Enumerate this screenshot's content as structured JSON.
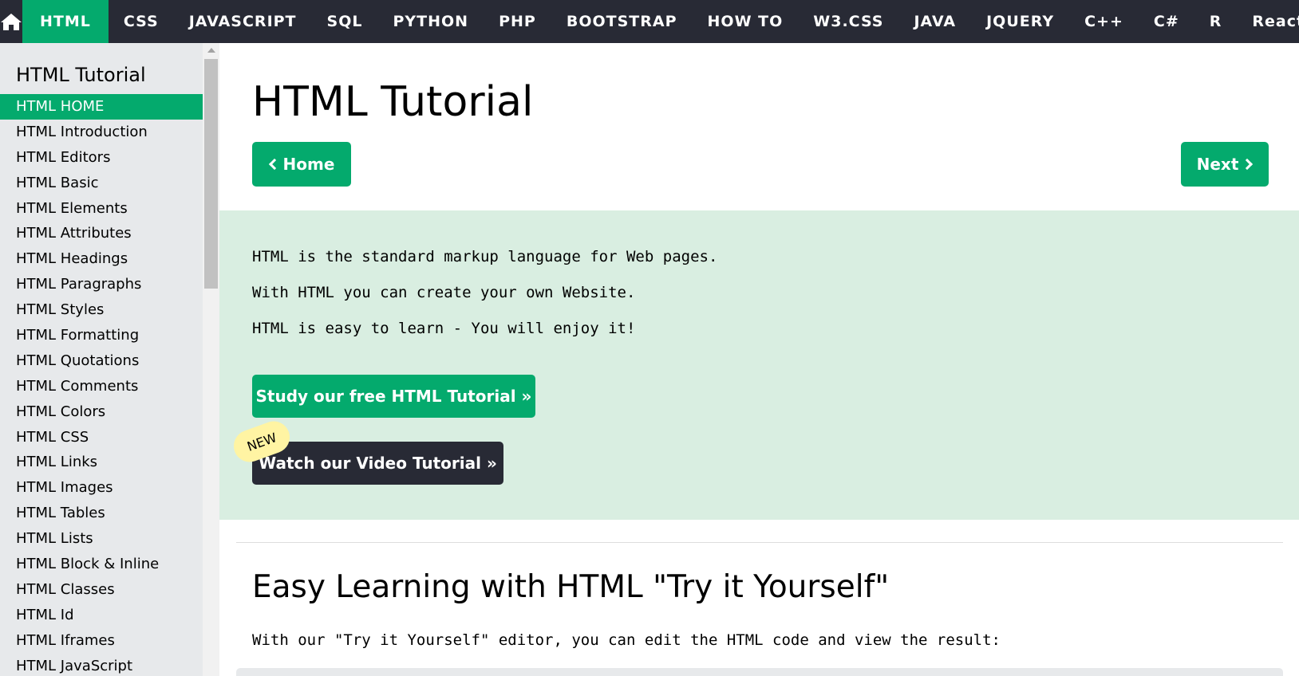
{
  "topnav": {
    "home_icon": "home-icon",
    "items": [
      {
        "label": "HTML",
        "active": true
      },
      {
        "label": "CSS"
      },
      {
        "label": "JAVASCRIPT"
      },
      {
        "label": "SQL"
      },
      {
        "label": "PYTHON"
      },
      {
        "label": "PHP"
      },
      {
        "label": "BOOTSTRAP"
      },
      {
        "label": "HOW TO"
      },
      {
        "label": "W3.CSS"
      },
      {
        "label": "JAVA"
      },
      {
        "label": "JQUERY"
      },
      {
        "label": "C++"
      },
      {
        "label": "C#"
      },
      {
        "label": "R"
      },
      {
        "label": "React"
      }
    ]
  },
  "sidebar": {
    "title": "HTML Tutorial",
    "items": [
      {
        "label": "HTML HOME",
        "active": true
      },
      {
        "label": "HTML Introduction"
      },
      {
        "label": "HTML Editors"
      },
      {
        "label": "HTML Basic"
      },
      {
        "label": "HTML Elements"
      },
      {
        "label": "HTML Attributes"
      },
      {
        "label": "HTML Headings"
      },
      {
        "label": "HTML Paragraphs"
      },
      {
        "label": "HTML Styles"
      },
      {
        "label": "HTML Formatting"
      },
      {
        "label": "HTML Quotations"
      },
      {
        "label": "HTML Comments"
      },
      {
        "label": "HTML Colors"
      },
      {
        "label": "HTML CSS"
      },
      {
        "label": "HTML Links"
      },
      {
        "label": "HTML Images"
      },
      {
        "label": "HTML Tables"
      },
      {
        "label": "HTML Lists"
      },
      {
        "label": "HTML Block & Inline"
      },
      {
        "label": "HTML Classes"
      },
      {
        "label": "HTML Id"
      },
      {
        "label": "HTML Iframes"
      },
      {
        "label": "HTML JavaScript"
      }
    ]
  },
  "main": {
    "title": "HTML Tutorial",
    "home_button": "Home",
    "next_button": "Next",
    "intro": {
      "lines": [
        "HTML is the standard markup language for Web pages.",
        "With HTML you can create your own Website.",
        "HTML is easy to learn - You will enjoy it!"
      ],
      "study_button": "Study our free HTML Tutorial »",
      "video_button": "Watch our Video Tutorial »",
      "new_badge": "NEW"
    },
    "section": {
      "title": "Easy Learning with HTML \"Try it Yourself\"",
      "text": "With our \"Try it Yourself\" editor, you can edit the HTML code and view the result:"
    }
  },
  "colors": {
    "accent": "#04AA6D",
    "nav_bg": "#282A35",
    "sidebar_bg": "#E7E9EB",
    "intro_bg": "#D9EEE1",
    "badge_bg": "#FFF4A3"
  }
}
